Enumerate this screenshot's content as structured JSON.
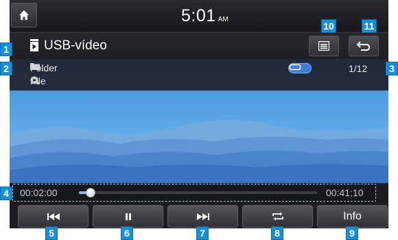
{
  "status": {
    "time": "5:01",
    "ampm": "AM"
  },
  "titlebar": {
    "title": "USB-vídeo"
  },
  "info": {
    "folder_label": "Folder",
    "file_label": "File",
    "track_count": "1/12"
  },
  "progress": {
    "elapsed": "00:02:00",
    "total": "00:41:10",
    "fraction": 0.05
  },
  "controls": {
    "info_label": "Info"
  },
  "callouts": {
    "c1": "1",
    "c2": "2",
    "c3": "3",
    "c4": "4",
    "c5": "5",
    "c6": "6",
    "c7": "7",
    "c8": "8",
    "c9": "9",
    "c10": "10",
    "c11": "11"
  },
  "colors": {
    "badge": "#1b8fd6",
    "repeat_active": "#3f7cd6"
  },
  "icons": [
    "home-icon",
    "video-file-icon",
    "list-icon",
    "back-icon",
    "folder-icon",
    "file-icon",
    "repeat-icon",
    "previous-icon",
    "pause-icon",
    "next-icon"
  ]
}
